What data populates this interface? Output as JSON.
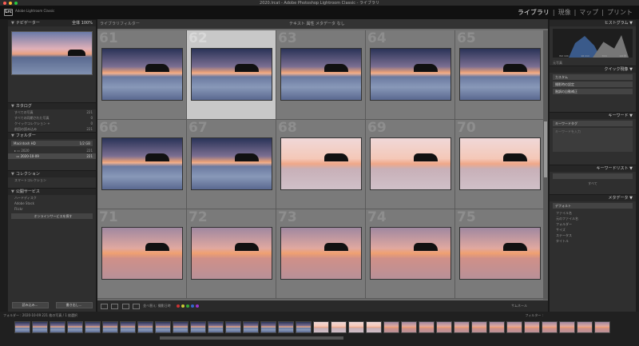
{
  "window": {
    "title": "2020.lrcat - Adobe Photoshop Lightroom Classic - ライブラリ"
  },
  "identity": {
    "brand": "Adobe Lightroom Classic",
    "logo": "Lrc"
  },
  "modules": {
    "library": "ライブラリ",
    "sep": "|",
    "develop": "現像",
    "map": "マップ",
    "print": "プリント"
  },
  "left_panel": {
    "navigator": {
      "title": "ナビゲーター",
      "zoom": "全体 100%"
    },
    "catalog": {
      "title": "カタログ",
      "items": [
        {
          "label": "すべての写真",
          "count": "221"
        },
        {
          "label": "すべての同期された写真",
          "count": "0"
        },
        {
          "label": "クイックコレクション +",
          "count": "0"
        },
        {
          "label": "前回の読み込み",
          "count": "221"
        }
      ]
    },
    "folders": {
      "title": "フォルダー",
      "drive": "Macintosh HD",
      "drive_info": "1/2 GB",
      "items": [
        {
          "label": "2020",
          "count": "221"
        },
        {
          "label": "2020-10-09",
          "count": "221"
        }
      ]
    },
    "collections": {
      "title": "コレクション",
      "items": [
        {
          "label": "スマートコレクション"
        }
      ]
    },
    "publish": {
      "title": "公開サービス",
      "items": [
        {
          "label": "ハードディスク",
          "count": ""
        },
        {
          "label": "Adobe Stock",
          "count": ""
        },
        {
          "label": "Flickr",
          "count": ""
        }
      ],
      "find_more": "オンラインサービスを探す"
    },
    "import_btn": "読み込み...",
    "export_btn": "書き出し..."
  },
  "center": {
    "filter_label": "ライブラリフィルター",
    "filter_tabs": "テキスト  属性  メタデータ  なし",
    "cells": [
      {
        "num": "61",
        "tone": "t1",
        "selected": false
      },
      {
        "num": "62",
        "tone": "t1",
        "selected": true
      },
      {
        "num": "63",
        "tone": "t1",
        "selected": false
      },
      {
        "num": "64",
        "tone": "t1",
        "selected": false
      },
      {
        "num": "65",
        "tone": "t1",
        "selected": false
      },
      {
        "num": "66",
        "tone": "t1",
        "selected": false
      },
      {
        "num": "67",
        "tone": "t1",
        "selected": false
      },
      {
        "num": "68",
        "tone": "t2",
        "selected": false
      },
      {
        "num": "69",
        "tone": "t2",
        "selected": false
      },
      {
        "num": "70",
        "tone": "t2",
        "selected": false
      },
      {
        "num": "71",
        "tone": "t3",
        "selected": false
      },
      {
        "num": "72",
        "tone": "t3",
        "selected": false
      },
      {
        "num": "73",
        "tone": "t3",
        "selected": false
      },
      {
        "num": "74",
        "tone": "t3",
        "selected": false
      },
      {
        "num": "75",
        "tone": "t3",
        "selected": false
      }
    ],
    "toolbar": {
      "sort_label": "並べ替え: 撮影日時",
      "thumb_label": "サムネール"
    }
  },
  "right_panel": {
    "histogram": {
      "title": "ヒストグラム",
      "info": [
        "ISO 100",
        "16 mm",
        "f/16",
        "1/6 秒"
      ],
      "original": "元写真"
    },
    "quick_develop": {
      "title": "クイック現像",
      "preset_label": "カスタム",
      "wb_label": "撮影時の設定",
      "tone_label": "階調の自動補正"
    },
    "keywords": {
      "title": "キーワード",
      "tag_label": "キーワードタグ",
      "tag_value": "キーワードを入力"
    },
    "keyword_list": {
      "title": "キーワードリスト",
      "filter": "すべて"
    },
    "metadata": {
      "title": "メタデータ",
      "preset": "デフォルト",
      "fields": [
        "ファイル名",
        "元のファイル名",
        "フォルダー",
        "サイズ",
        "ステータス",
        "タイトル"
      ]
    }
  },
  "filmstrip": {
    "label": "フォルダー : 2020-10-09   221 枚の写真 / 1 枚選択",
    "filter": "フィルター :"
  },
  "colors": {
    "accent": "#cfcfcf",
    "panel": "#2f2f2f",
    "grid": "#6c6c6c"
  }
}
